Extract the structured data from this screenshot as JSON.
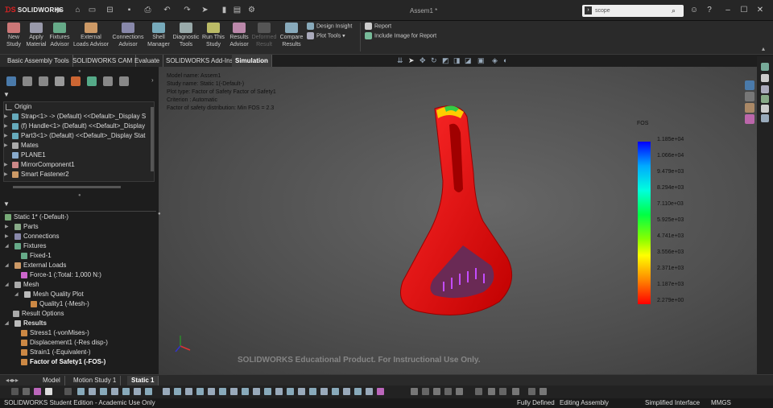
{
  "app": {
    "logo": "SOLIDWORKS",
    "doc_title": "Assem1 *"
  },
  "search": {
    "value": "scope"
  },
  "ribbon": {
    "buttons": [
      {
        "label": "New Study",
        "color": "#c77"
      },
      {
        "label": "Apply Material",
        "color": "#99a"
      },
      {
        "label": "Fixtures Advisor",
        "color": "#6a8"
      },
      {
        "label": "External Loads Advisor",
        "color": "#c96"
      },
      {
        "label": "Connections Advisor",
        "color": "#88a"
      },
      {
        "label": "Shell Manager",
        "color": "#7ab"
      },
      {
        "label": "Diagnostic Tools",
        "color": "#9aa"
      },
      {
        "label": "Run This Study",
        "color": "#bb6"
      },
      {
        "label": "Results Advisor",
        "color": "#b8a"
      },
      {
        "label": "Deformed Result",
        "color": "#555"
      },
      {
        "label": "Compare Results",
        "color": "#8ab"
      }
    ],
    "design_insight": "Design Insight",
    "plot_tools": "Plot Tools",
    "report": "Report",
    "include_image": "Include Image for Report"
  },
  "tabs": [
    "Basic Assembly Tools",
    "SOLIDWORKS CAM",
    "Evaluate",
    "SOLIDWORKS Add-Ins",
    "Simulation"
  ],
  "tree_top": [
    {
      "label": "Origin",
      "arrow": false
    },
    {
      "label": "Strap<1> -> (Default) <<Default>_Display S",
      "arrow": true
    },
    {
      "label": "(f) Handle<1> (Default) <<Default>_Display",
      "arrow": true
    },
    {
      "label": "Part3<1> (Default) <<Default>_Display Stat",
      "arrow": true
    },
    {
      "label": "Mates",
      "arrow": true
    },
    {
      "label": "PLANE1",
      "arrow": false
    },
    {
      "label": "MirrorComponent1",
      "arrow": true
    },
    {
      "label": "Smart Fastener2",
      "arrow": true
    }
  ],
  "study_tree": [
    {
      "label": "Static 1* (-Default-)",
      "indent": 0,
      "arrow": false,
      "bold": false
    },
    {
      "label": "Parts",
      "indent": 1,
      "arrow": true,
      "bold": false
    },
    {
      "label": "Connections",
      "indent": 1,
      "arrow": true,
      "bold": false
    },
    {
      "label": "Fixtures",
      "indent": 1,
      "arrow": true,
      "bold": false
    },
    {
      "label": "Fixed-1",
      "indent": 2,
      "arrow": false,
      "bold": false
    },
    {
      "label": "External Loads",
      "indent": 1,
      "arrow": true,
      "bold": false
    },
    {
      "label": "Force-1 (:Total: 1,000 N:)",
      "indent": 2,
      "arrow": false,
      "bold": false
    },
    {
      "label": "Mesh",
      "indent": 1,
      "arrow": true,
      "bold": false
    },
    {
      "label": "Mesh Quality Plot",
      "indent": 2,
      "arrow": true,
      "bold": false
    },
    {
      "label": "Quality1 (-Mesh-)",
      "indent": 3,
      "arrow": false,
      "bold": false
    },
    {
      "label": "Result Options",
      "indent": 1,
      "arrow": false,
      "bold": false
    },
    {
      "label": "Results",
      "indent": 1,
      "arrow": true,
      "bold": true
    },
    {
      "label": "Stress1 (-vonMises-)",
      "indent": 2,
      "arrow": false,
      "bold": false
    },
    {
      "label": "Displacement1 (-Res disp-)",
      "indent": 2,
      "arrow": false,
      "bold": false
    },
    {
      "label": "Strain1 (-Equivalent-)",
      "indent": 2,
      "arrow": false,
      "bold": false
    },
    {
      "label": "Factor of Safety1 (-FOS-)",
      "indent": 2,
      "arrow": false,
      "bold": true
    }
  ],
  "model_info": [
    "Model name: Assem1",
    "Study name: Static 1(-Default-)",
    "Plot type: Factor of Safety Factor of Safety1",
    "Criterion : Automatic",
    "Factor of safety distribution: Min FOS = 2.3"
  ],
  "legend": {
    "title": "FOS",
    "values": [
      "1.185e+04",
      "1.066e+04",
      "9.479e+03",
      "8.294e+03",
      "7.110e+03",
      "5.925e+03",
      "4.741e+03",
      "3.556e+03",
      "2.371e+03",
      "1.187e+03",
      "2.279e+00"
    ]
  },
  "watermark": "SOLIDWORKS Educational Product. For Instructional Use Only.",
  "bottom_tabs": [
    "Model",
    "Motion Study 1",
    "Static 1"
  ],
  "status": {
    "edition": "SOLIDWORKS Student Edition - Academic Use Only",
    "defined": "Fully Defined",
    "mode": "Editing Assembly",
    "interface": "Simplified Interface",
    "units": "MMGS"
  }
}
